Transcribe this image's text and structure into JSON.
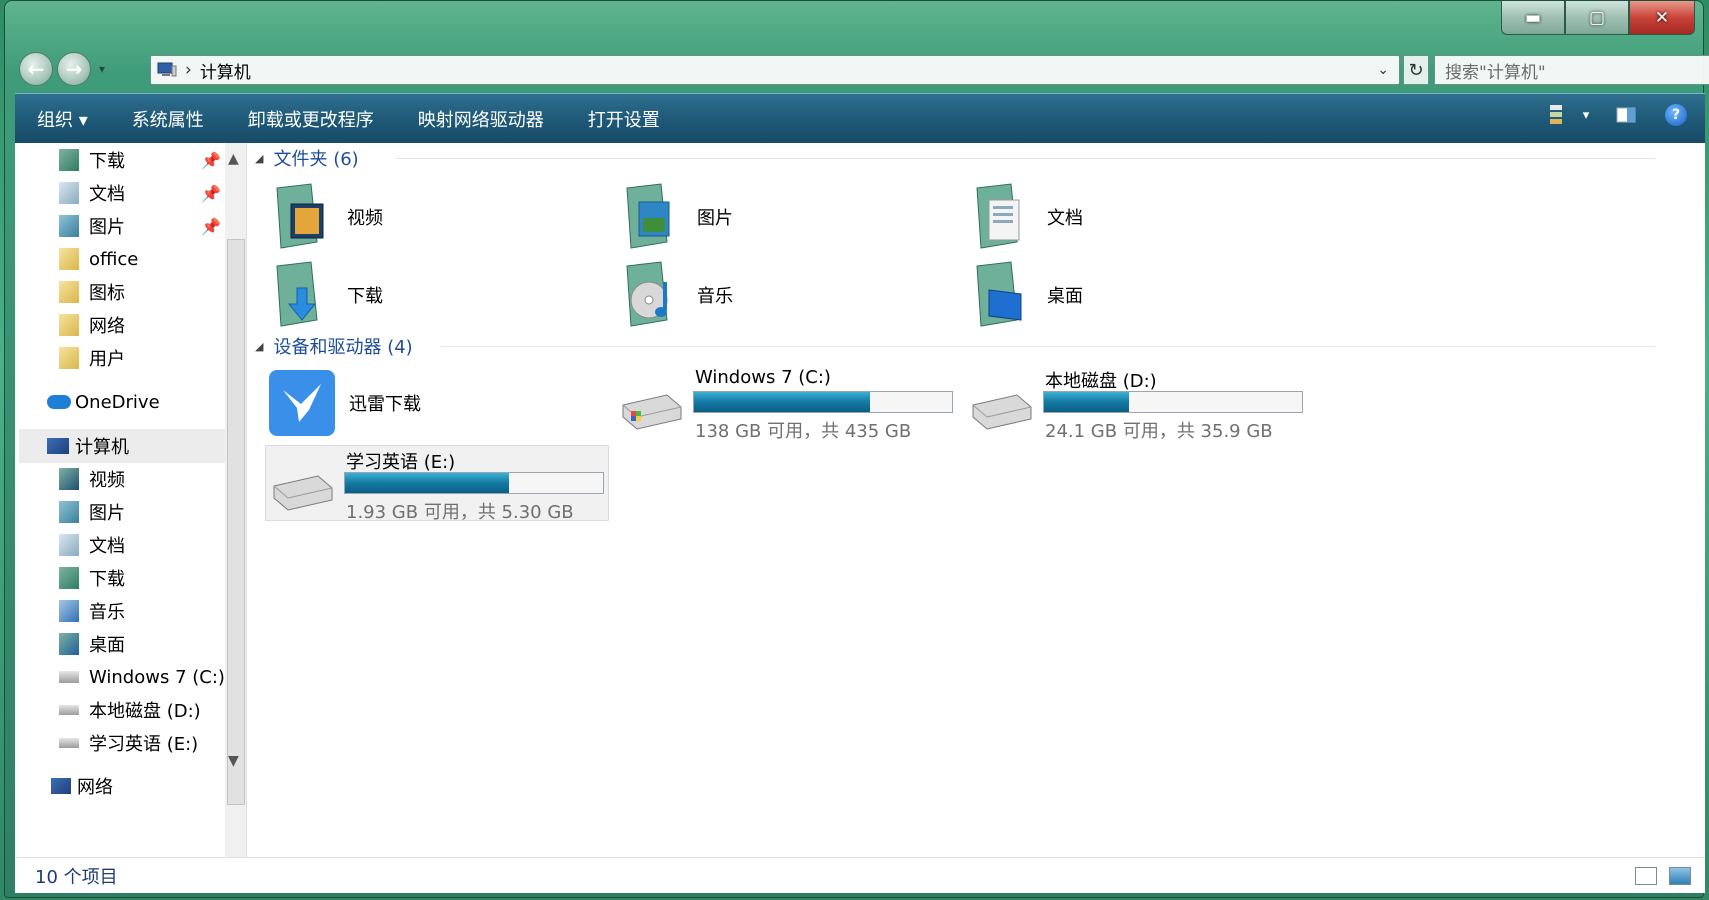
{
  "window": {
    "buttons": {
      "minimize": "▬",
      "maximize": "▢",
      "close": "✕"
    }
  },
  "address": {
    "breadcrumb": "计算机",
    "search_placeholder": "搜索\"计算机\""
  },
  "toolbar": {
    "items": [
      "组织 ▾",
      "系统属性",
      "卸载或更改程序",
      "映射网络驱动器",
      "打开设置"
    ],
    "help": "?"
  },
  "nav": {
    "quick": [
      {
        "label": "下载",
        "pinned": true
      },
      {
        "label": "文档",
        "pinned": true
      },
      {
        "label": "图片",
        "pinned": true
      },
      {
        "label": "office",
        "pinned": false
      },
      {
        "label": "图标",
        "pinned": false
      },
      {
        "label": "网络",
        "pinned": false
      },
      {
        "label": "用户",
        "pinned": false
      }
    ],
    "onedrive": "OneDrive",
    "computer": "计算机",
    "computer_children": [
      "视频",
      "图片",
      "文档",
      "下载",
      "音乐",
      "桌面",
      "Windows 7 (C:)",
      "本地磁盘 (D:)",
      "学习英语 (E:)"
    ],
    "network": "网络"
  },
  "content": {
    "folders_header": "文件夹 (6)",
    "folders": [
      "视频",
      "图片",
      "文档",
      "下载",
      "音乐",
      "桌面"
    ],
    "devices_header": "设备和驱动器 (4)",
    "app_drive": "迅雷下载",
    "drives": [
      {
        "name": "Windows 7 (C:)",
        "free": "138 GB 可用，共 435 GB",
        "used_fraction": 0.683
      },
      {
        "name": "本地磁盘 (D:)",
        "free": "24.1 GB 可用，共 35.9 GB",
        "used_fraction": 0.329
      },
      {
        "name": "学习英语 (E:)",
        "free": "1.93 GB 可用，共 5.30 GB",
        "used_fraction": 0.636
      }
    ]
  },
  "status": {
    "count": "10 个项目"
  },
  "colors": {
    "accent": "#1e4e9a",
    "toolbar": "#1f5a78",
    "bar_fill": "#1479a3"
  }
}
